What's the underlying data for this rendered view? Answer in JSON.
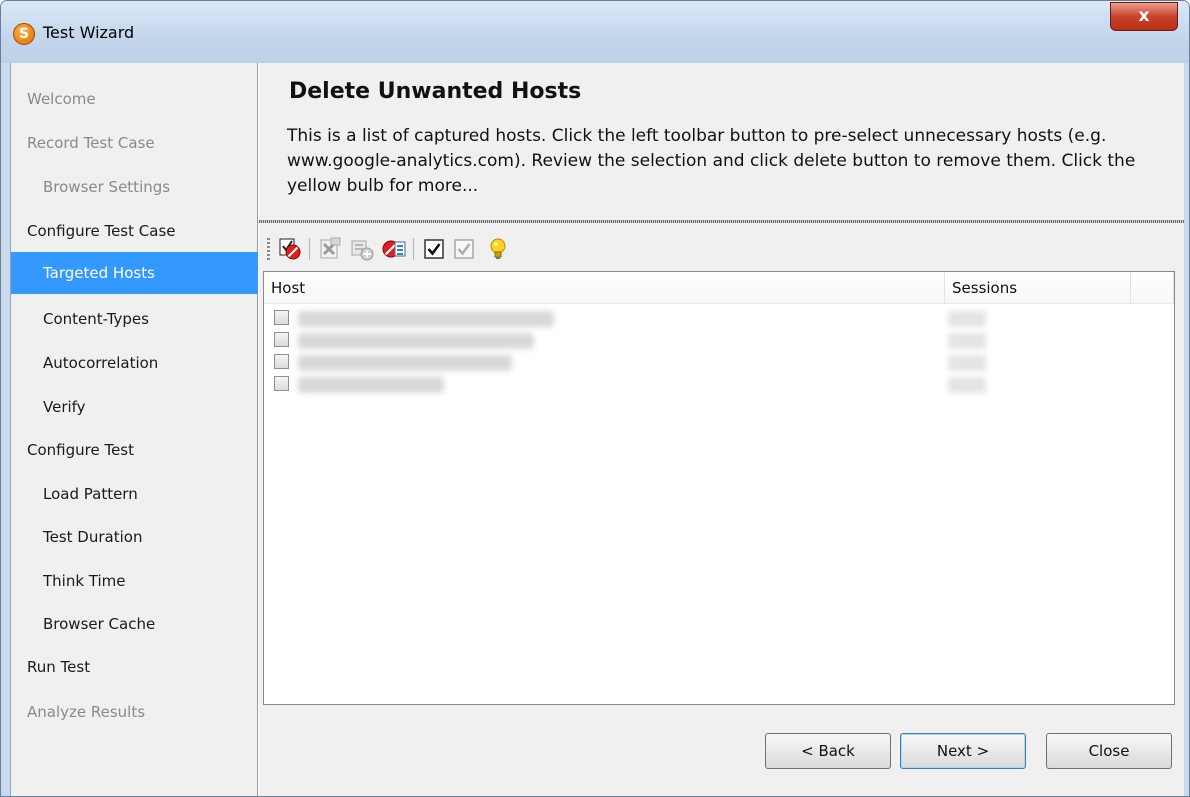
{
  "window": {
    "title": "Test Wizard",
    "app_icon_letter": "S",
    "close_label": "x"
  },
  "sidebar": {
    "items": [
      {
        "label": "Welcome",
        "level": "top",
        "state": "disabled"
      },
      {
        "label": "Record Test Case",
        "level": "top",
        "state": "disabled"
      },
      {
        "label": "Browser Settings",
        "level": "sub",
        "state": "disabled"
      },
      {
        "label": "Configure Test Case",
        "level": "top",
        "state": "normal"
      },
      {
        "label": "Targeted Hosts",
        "level": "sub",
        "state": "selected"
      },
      {
        "label": "Content-Types",
        "level": "sub",
        "state": "normal"
      },
      {
        "label": "Autocorrelation",
        "level": "sub",
        "state": "normal"
      },
      {
        "label": "Verify",
        "level": "sub",
        "state": "normal"
      },
      {
        "label": "Configure Test",
        "level": "top",
        "state": "normal"
      },
      {
        "label": "Load Pattern",
        "level": "sub",
        "state": "normal"
      },
      {
        "label": "Test Duration",
        "level": "sub",
        "state": "normal"
      },
      {
        "label": "Think Time",
        "level": "sub",
        "state": "normal"
      },
      {
        "label": "Browser Cache",
        "level": "sub",
        "state": "normal"
      },
      {
        "label": "Run Test",
        "level": "top",
        "state": "normal"
      },
      {
        "label": "Analyze Results",
        "level": "top",
        "state": "disabled"
      }
    ]
  },
  "main": {
    "title": "Delete Unwanted Hosts",
    "description": "This is a list of captured hosts. Click the left toolbar button to pre-select unnecessary hosts (e.g. www.google-analytics.com). Review the selection and click delete button to remove them. Click the yellow bulb for more..."
  },
  "toolbar": {
    "buttons": [
      {
        "icon": "preselect-hosts-icon",
        "enabled": true
      },
      {
        "icon": "delete-selected-icon",
        "enabled": false
      },
      {
        "icon": "add-host-icon",
        "enabled": false
      },
      {
        "icon": "clear-selection-icon",
        "enabled": true
      },
      {
        "icon": "check-all-icon",
        "enabled": true
      },
      {
        "icon": "uncheck-all-icon",
        "enabled": false
      },
      {
        "icon": "yellow-bulb-icon",
        "enabled": true
      }
    ]
  },
  "table": {
    "columns": [
      "Host",
      "Sessions",
      ""
    ],
    "rows": [
      {
        "host": "",
        "sessions": "",
        "checked": false
      },
      {
        "host": "",
        "sessions": "",
        "checked": false
      },
      {
        "host": "",
        "sessions": "",
        "checked": false
      },
      {
        "host": "",
        "sessions": "",
        "checked": false
      }
    ]
  },
  "buttons": {
    "back": "< Back",
    "next": "Next >",
    "close": "Close"
  },
  "colors": {
    "selection": "#3399ff",
    "panel": "#f0f0f0",
    "title_bar": "#c4d6ec",
    "close_button": "#c9432a",
    "bulb": "#f5c400"
  }
}
